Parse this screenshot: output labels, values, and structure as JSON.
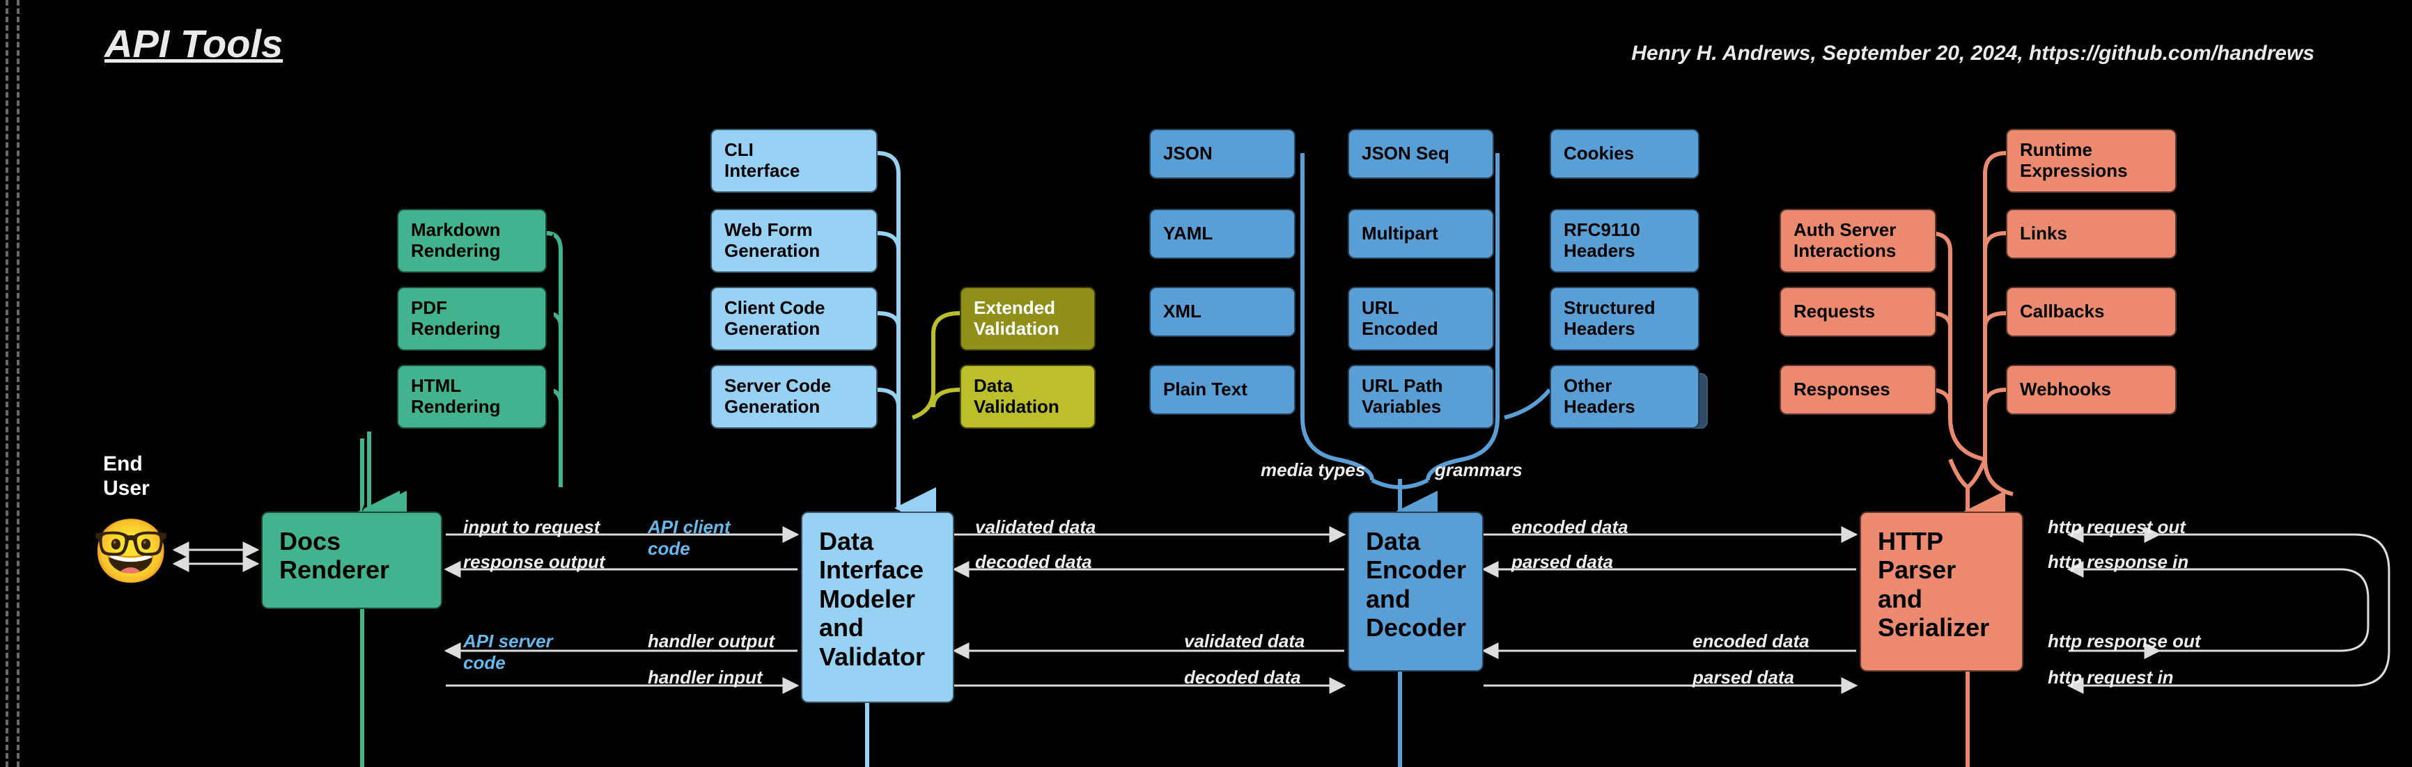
{
  "title": "API Tools",
  "attribution": "Henry H. Andrews, September 20, 2024, https://github.com/handrews",
  "end_user_label": "End\nUser",
  "emoji": "🤓",
  "main_nodes": {
    "docs_renderer": "Docs\nRenderer",
    "data_interface": "Data\nInterface\nModeler\nand\nValidator",
    "data_encoder": "Data\nEncoder\nand\nDecoder",
    "http_parser": "HTTP\nParser\nand\nSerializer"
  },
  "docs_col": [
    "Markdown\nRendering",
    "PDF\nRendering",
    "HTML\nRendering"
  ],
  "iface_col": [
    "CLI\nInterface",
    "Web Form\nGeneration",
    "Client Code\nGeneration",
    "Server Code\nGeneration"
  ],
  "validation_col": [
    "Extended\nValidation",
    "Data\nValidation"
  ],
  "encoder_cols": {
    "left": [
      "JSON",
      "YAML",
      "XML",
      "Plain Text"
    ],
    "right": [
      "JSON Seq",
      "Multipart",
      "URL\nEncoded",
      "URL Path\nVariables"
    ],
    "headers": [
      "Cookies",
      "RFC9110\nHeaders",
      "Structured\nHeaders",
      "Other\nHeaders"
    ]
  },
  "http_left_col": [
    "Auth Server\nInteractions",
    "Requests",
    "Responses"
  ],
  "http_right_col": [
    "Runtime\nExpressions",
    "Links",
    "Callbacks",
    "Webhooks"
  ],
  "bracket_labels": {
    "media_types": "media types",
    "grammars": "grammars"
  },
  "flows": {
    "input_to_request": "input to request",
    "response_output": "response output",
    "api_client_code": "API client\ncode",
    "api_server_code": "API server\ncode",
    "handler_output": "handler output",
    "handler_input": "handler input",
    "validated_data": "validated data",
    "decoded_data": "decoded data",
    "encoded_data": "encoded data",
    "parsed_data": "parsed data",
    "http_request_out": "http request out",
    "http_response_in": "http response in",
    "http_response_out": "http response out",
    "http_request_in": "http request in"
  },
  "colors": {
    "green": "#43b38f",
    "blue_light": "#97d1f4",
    "blue_mid": "#5a9ed6",
    "olive": "#bcbf2a",
    "olive_dark": "#8f8f1a",
    "coral": "#eb8a6f"
  }
}
